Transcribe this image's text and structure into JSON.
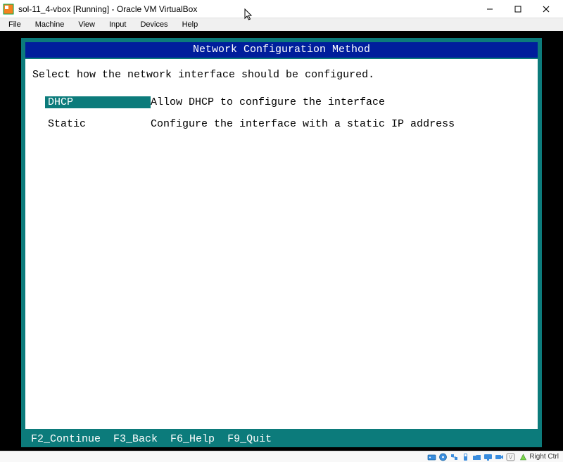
{
  "window": {
    "title": "sol-11_4-vbox [Running] - Oracle VM VirtualBox"
  },
  "menubar": {
    "items": [
      "File",
      "Machine",
      "View",
      "Input",
      "Devices",
      "Help"
    ]
  },
  "installer": {
    "header": "Network Configuration Method",
    "instruction": "Select how the network interface should be configured.",
    "options": [
      {
        "label": "DHCP",
        "desc": "Allow DHCP to configure the interface",
        "selected": true
      },
      {
        "label": "Static",
        "desc": "Configure the interface with a static IP address",
        "selected": false
      }
    ],
    "footer": {
      "f2": "F2_Continue",
      "f3": "F3_Back",
      "f6": "F6_Help",
      "f9": "F9_Quit"
    }
  },
  "statusbar": {
    "capture_key": "Right Ctrl"
  }
}
